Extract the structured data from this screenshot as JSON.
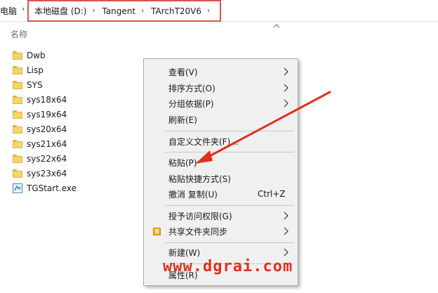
{
  "address_bar": {
    "root": "电脑",
    "crumbs": [
      "本地磁盘 (D:)",
      "Tangent",
      "TArchT20V6"
    ]
  },
  "file_list": {
    "column_header": "名称",
    "items": [
      {
        "name": "Dwb",
        "type": "folder"
      },
      {
        "name": "Lisp",
        "type": "folder"
      },
      {
        "name": "SYS",
        "type": "folder"
      },
      {
        "name": "sys18x64",
        "type": "folder"
      },
      {
        "name": "sys19x64",
        "type": "folder"
      },
      {
        "name": "sys20x64",
        "type": "folder"
      },
      {
        "name": "sys21x64",
        "type": "folder"
      },
      {
        "name": "sys22x64",
        "type": "folder"
      },
      {
        "name": "sys23x64",
        "type": "folder"
      },
      {
        "name": "TGStart.exe",
        "type": "exe"
      }
    ]
  },
  "context_menu": {
    "items": [
      {
        "label": "查看(V)"
      },
      {
        "label": "排序方式(O)"
      },
      {
        "label": "分组依据(P)"
      },
      {
        "label": "刷新(E)"
      },
      {
        "label": "自定义文件夹(F)..."
      },
      {
        "label": "粘贴(P)"
      },
      {
        "label": "粘贴快捷方式(S)"
      },
      {
        "label": "撤消 复制(U)",
        "shortcut": "Ctrl+Z"
      },
      {
        "label": "授予访问权限(G)"
      },
      {
        "label": "共享文件夹同步"
      },
      {
        "label": "新建(W)"
      },
      {
        "label": "属性(R)"
      }
    ]
  },
  "watermark": "www.dgrai.com",
  "colors": {
    "highlight_border": "#d9534f",
    "annotation_arrow": "#e0301e",
    "folder": "#f6d46a"
  }
}
